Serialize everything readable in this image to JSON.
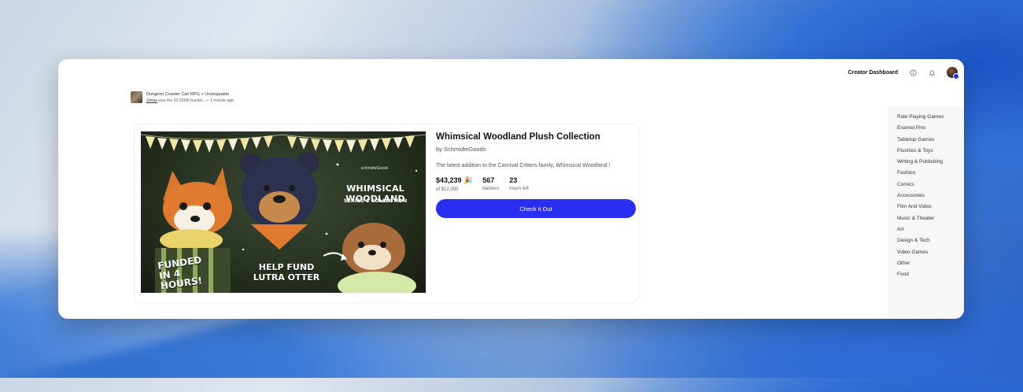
{
  "header": {
    "creator_dashboard": "Creator Dashboard",
    "info_icon": "info-icon",
    "bell_icon": "bell-icon",
    "avatar": "user-avatar"
  },
  "activity": {
    "project": "Dungeon Crawler Carl RPG + Unstoppable",
    "user": "Jonas",
    "message": "was the 26,000th backer.",
    "time": "— 1 minute ago"
  },
  "project": {
    "title": "Whimsical Woodland Plush Collection",
    "byline": "by SchmidteGoods",
    "description": "The latest addition to the Carnival Critters family, Whimsical Woodland !",
    "image": {
      "brand": "schmidteGoods",
      "title": "WHIMSICAL WOODLAND",
      "subtitle": "SERIES 1 COLLECTION",
      "funded": "FUNDED IN 4 HOURS!",
      "help": "HELP FUND LUTRA OTTER"
    },
    "stats": [
      {
        "value": "$43,239 🎉",
        "label": "of $12,000"
      },
      {
        "value": "567",
        "label": "backers"
      },
      {
        "value": "23",
        "label": "hours left"
      }
    ],
    "cta": "Check it Out"
  },
  "categories": [
    "Role Playing Games",
    "Enamel Pins",
    "Tabletop Games",
    "Plushies & Toys",
    "Writing & Publishing",
    "Fashion",
    "Comics",
    "Accessories",
    "Film And Video",
    "Music & Theater",
    "Art",
    "Design & Tech",
    "Video Games",
    "Other",
    "Food"
  ],
  "colors": {
    "accent": "#2a2ef0",
    "text": "#111111"
  }
}
